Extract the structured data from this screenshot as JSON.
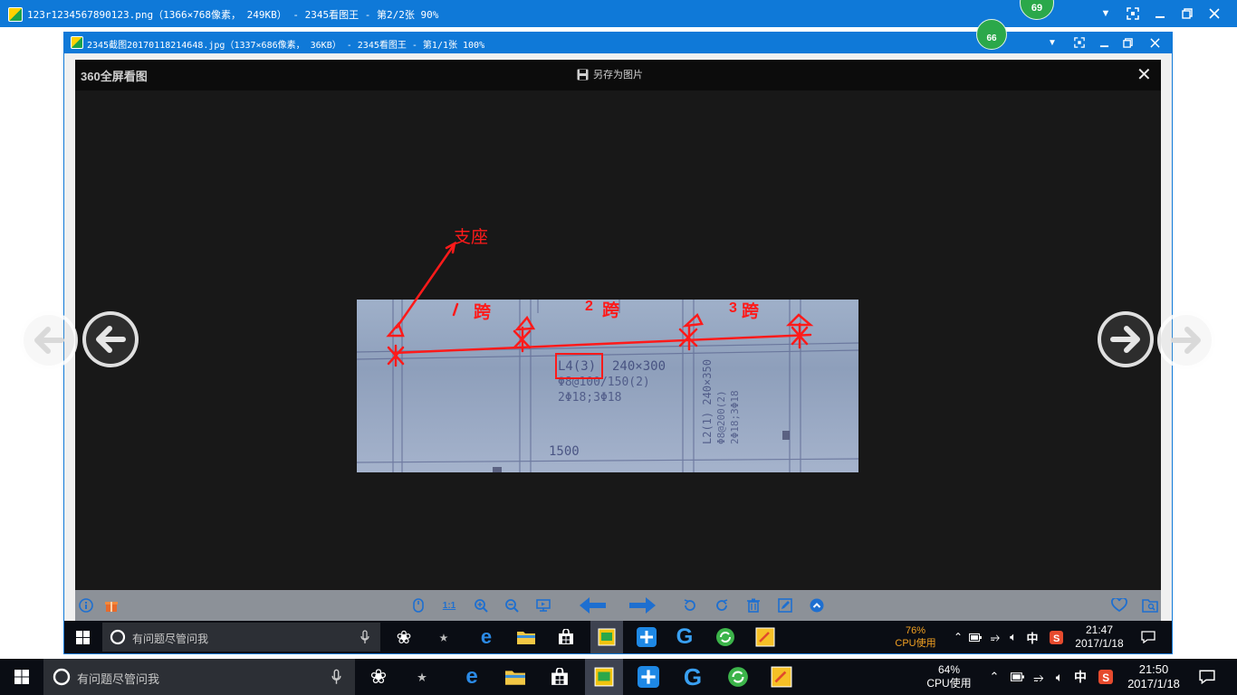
{
  "outer_window": {
    "title": "123r1234567890123.png（1366×768像素， 249KB） - 2345看图王 - 第2/2张 90%",
    "badge": "69"
  },
  "inner_window": {
    "title": "2345截图20170118214648.jpg（1337×686像素， 36KB） - 2345看图王 - 第1/1张 100%",
    "badge": "66"
  },
  "viewer": {
    "brand": "360全屏看图",
    "save_label": "另存为图片",
    "close": "✕"
  },
  "annotations": {
    "support": "支座",
    "span1_num": "1",
    "span1": "跨",
    "span2_num": "2",
    "span2": "跨",
    "span3_num": "3",
    "span3": "跨"
  },
  "drawing_text": {
    "beam_label": "L4(3)",
    "beam_size": "240×300",
    "stirrup": "Φ8@100/150(2)",
    "rebar": "2Φ18;3Φ18",
    "dim": "1500",
    "side_label": "L2(1) 240×350",
    "side_stirrup": "Φ8@200(2)",
    "side_rebar": "2Φ18;3Φ18"
  },
  "inner_taskbar": {
    "search_placeholder": "有问题尽管问我",
    "cpu_percent": "76%",
    "cpu_label": "CPU使用",
    "ime": "中",
    "time": "21:47",
    "date": "2017/1/18"
  },
  "outer_taskbar": {
    "search_placeholder": "有问题尽管问我",
    "cpu_percent": "64%",
    "cpu_label": "CPU使用",
    "ime": "中",
    "time": "21:50",
    "date": "2017/1/18"
  },
  "colors": {
    "titlebar": "#0f79d8",
    "annotation_red": "#ff1a1a",
    "viewer_bg": "#181818",
    "taskbar": "#0a0d14",
    "cpu_orange": "#f2a122"
  }
}
